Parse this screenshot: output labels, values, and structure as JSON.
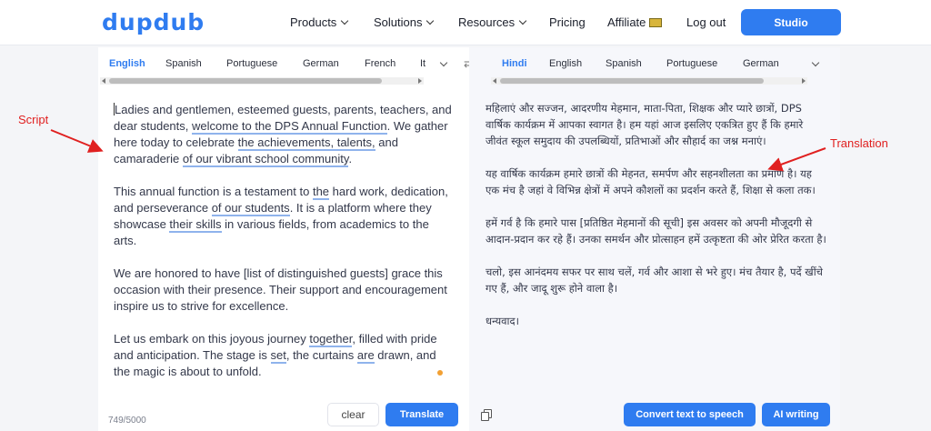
{
  "nav": {
    "logo": "dupdub",
    "items": [
      {
        "label": "Products",
        "has_dropdown": true
      },
      {
        "label": "Solutions",
        "has_dropdown": true
      },
      {
        "label": "Resources",
        "has_dropdown": true
      },
      {
        "label": "Pricing",
        "has_dropdown": false
      },
      {
        "label": "Affiliate",
        "has_dropdown": false
      },
      {
        "label": "Log out",
        "has_dropdown": false
      }
    ],
    "studio_label": "Studio"
  },
  "source_tabs": [
    "English",
    "Spanish",
    "Portuguese",
    "German",
    "French",
    "It"
  ],
  "target_tabs": [
    "Hindi",
    "English",
    "Spanish",
    "Portuguese",
    "German"
  ],
  "swap_icon": "⇄",
  "script": {
    "p1": {
      "a": "Ladies and gentlemen, esteemed guests, parents, teachers, and dear students, ",
      "b": "welcome to the DPS Annual Function",
      "c": ". We gather here today to celebrate ",
      "d": "the achievements, talents,",
      "e": " and camaraderie ",
      "f": "of our vibrant school community",
      "g": "."
    },
    "p2": {
      "a": "This annual function is a testament to ",
      "b": "the",
      "c": " hard work, dedication, and perseverance ",
      "d": "of our students",
      "e": ". It is a platform where they showcase ",
      "f": "their skills",
      "g": " in various fields, from academics to the arts."
    },
    "p3": "We are honored to have [list of distinguished guests] grace this occasion with their presence. Their support and encouragement inspire us to strive for excellence.",
    "p4": {
      "a": "Let us embark on this joyous journey ",
      "b": "together",
      "c": ", filled with pride and anticipation. The stage is ",
      "d": "set",
      "e": ", the curtains ",
      "f": "are",
      "g": " drawn, and the magic is about to unfold."
    }
  },
  "translation": {
    "p1": "महिलाएं और सज्जन, आदरणीय मेहमान, माता-पिता, शिक्षक और प्यारे छात्रों, DPS वार्षिक कार्यक्रम में आपका स्वागत है। हम यहां आज इसलिए एकत्रित हुए हैं कि हमारे जीवंत स्कूल समुदाय की उपलब्धियों, प्रतिभाओं और सौहार्द का जश्न मनाएं।",
    "p2": "यह वार्षिक कार्यक्रम हमारे छात्रों की मेहनत, समर्पण और सहनशीलता का प्रमाण है। यह एक मंच है जहां वे विभिन्न क्षेत्रों में अपने कौशलों का प्रदर्शन करते हैं, शिक्षा से कला तक।",
    "p3": "हमें गर्व है कि हमारे पास [प्रतिष्ठित मेहमानों की सूची] इस अवसर को अपनी मौजूदगी से आदान-प्रदान कर रहे हैं। उनका समर्थन और प्रोत्साहन हमें उत्कृष्टता की ओर प्रेरित करता है।",
    "p4": "चलो, इस आनंदमय सफर पर साथ चलें, गर्व और आशा से भरे हुए। मंच तैयार है, पर्दे खींचे गए हैं, और जादू शुरू होने वाला है।",
    "p5": "धन्यवाद।"
  },
  "footer": {
    "char_count": "749/5000",
    "clear_label": "clear",
    "translate_label": "Translate",
    "tts_label": "Convert text to speech",
    "ai_label": "AI writing"
  },
  "annotations": {
    "script_label": "Script",
    "translation_label": "Translation",
    "color": "#e02020"
  },
  "colors": {
    "accent": "#2f7cf0",
    "link_underline": "#8fb3ec",
    "indicator_dot": "#f2a033"
  }
}
